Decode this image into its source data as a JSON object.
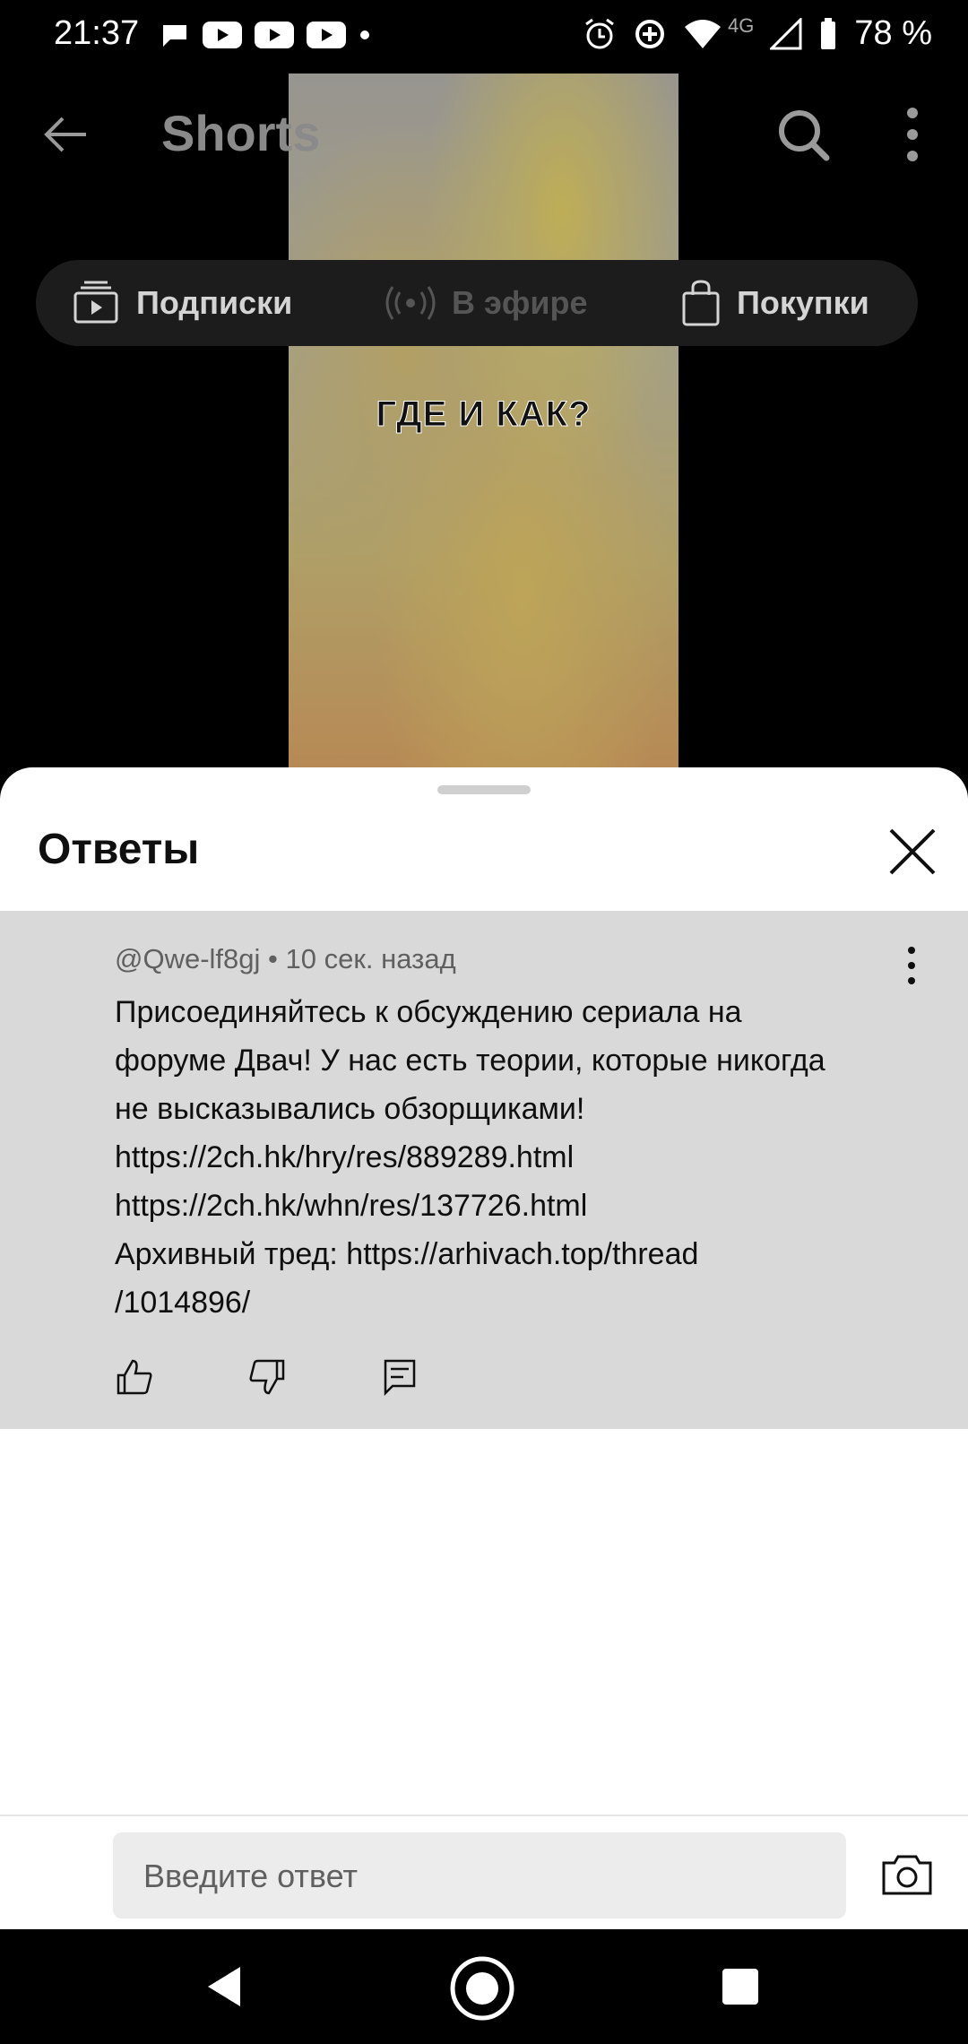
{
  "status_bar": {
    "time": "21:37",
    "network": "4G",
    "battery": "78 %"
  },
  "topbar": {
    "title": "Shorts"
  },
  "chips": {
    "subscriptions": "Подписки",
    "live": "В эфире",
    "shopping": "Покупки"
  },
  "video": {
    "caption": "ГДЕ И КАК?"
  },
  "sheet": {
    "title": "Ответы"
  },
  "comment": {
    "author": "@Qwe-lf8gj",
    "separator": "•",
    "time": "10 сек. назад",
    "lines": [
      "Присоединяйтесь к обсуждению сериала на",
      "форуме Двач! У нас есть теории, которые никогда",
      "не высказывались обзорщиками!",
      "https://2ch.hk/hry/res/889289.html",
      "https://2ch.hk/whn/res/137726.html",
      "Архивный тред: https://arhivach.top/thread",
      "/1014896/"
    ]
  },
  "reply": {
    "placeholder": "Введите ответ"
  }
}
